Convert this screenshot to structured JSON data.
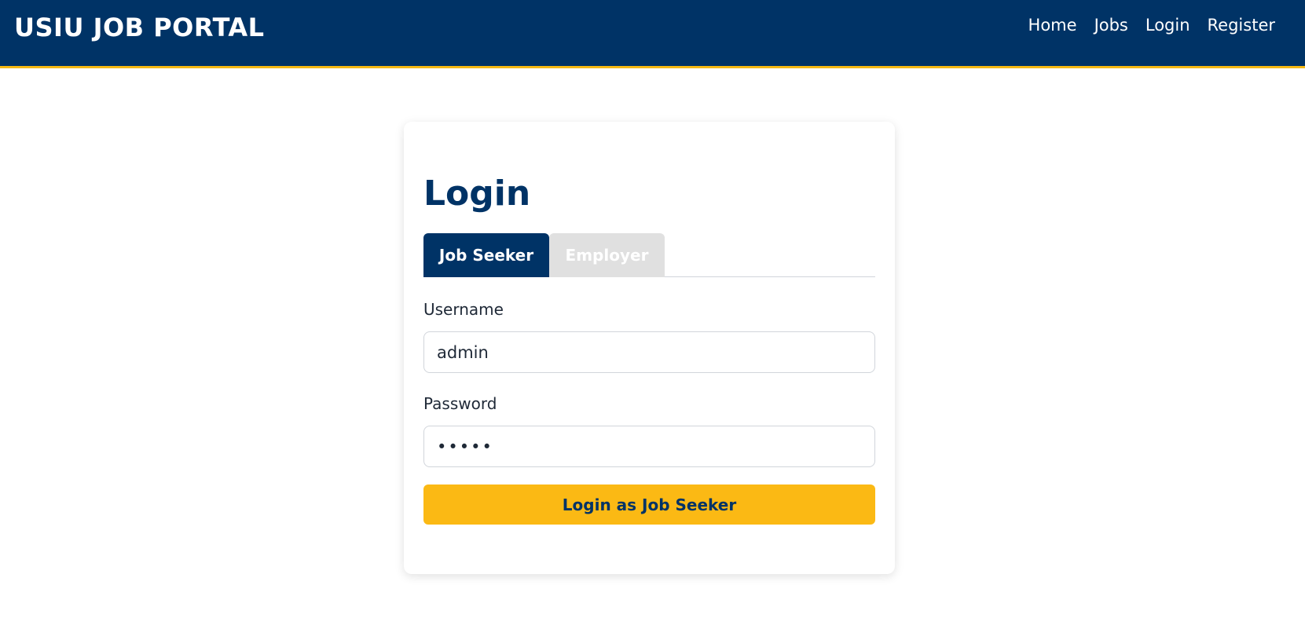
{
  "header": {
    "brand": "USIU JOB PORTAL",
    "nav": {
      "home": "Home",
      "jobs": "Jobs",
      "login": "Login",
      "register": "Register"
    }
  },
  "login": {
    "title": "Login",
    "tabs": {
      "job_seeker": "Job Seeker",
      "employer": "Employer",
      "active": "Job Seeker"
    },
    "username_label": "Username",
    "username_value": "admin",
    "password_label": "Password",
    "password_value": "admin",
    "submit_label": "Login as Job Seeker"
  },
  "colors": {
    "primary": "#003366",
    "accent": "#fbb914",
    "tab_inactive": "#e0e0e0"
  }
}
